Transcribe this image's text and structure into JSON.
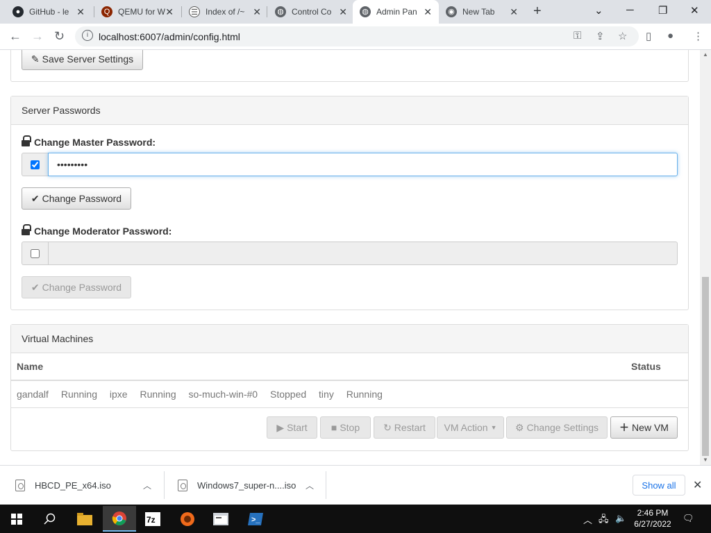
{
  "browser": {
    "tabs": [
      {
        "title": "GitHub - le",
        "icon": "github-icon"
      },
      {
        "title": "QEMU for W",
        "icon": "qemu-icon"
      },
      {
        "title": "Index of /~",
        "icon": "page-icon"
      },
      {
        "title": "Control Co",
        "icon": "globe-icon"
      },
      {
        "title": "Admin Pan",
        "icon": "globe-icon"
      },
      {
        "title": "New Tab",
        "icon": "chrome-icon"
      }
    ],
    "url": "localhost:6007/admin/config.html"
  },
  "server_settings": {
    "save_label": "Save Server Settings"
  },
  "passwords": {
    "heading": "Server Passwords",
    "master": {
      "label": "Change Master Password:",
      "checked": true,
      "value": "•••••••••",
      "button": "Change Password"
    },
    "moderator": {
      "label": "Change Moderator Password:",
      "checked": false,
      "value": "",
      "button": "Change Password"
    }
  },
  "vms": {
    "heading": "Virtual Machines",
    "columns": {
      "name": "Name",
      "status": "Status"
    },
    "rows": [
      {
        "name": "gandalf",
        "status": "Running"
      },
      {
        "name": "ipxe",
        "status": "Running"
      },
      {
        "name": "so-much-win-#0",
        "status": "Stopped"
      },
      {
        "name": "tiny",
        "status": "Running"
      }
    ],
    "actions": {
      "start": "Start",
      "stop": "Stop",
      "restart": "Restart",
      "vm_action": "VM Action",
      "change_settings": "Change Settings",
      "new_vm": "New VM"
    }
  },
  "downloads": {
    "items": [
      {
        "name": "HBCD_PE_x64.iso"
      },
      {
        "name": "Windows7_super-n....iso"
      }
    ],
    "show_all": "Show all"
  },
  "taskbar": {
    "time": "2:46 PM",
    "date": "6/27/2022",
    "apps": [
      "file-explorer",
      "chrome",
      "7zip",
      "qemu",
      "terminal-window",
      "powershell"
    ]
  }
}
